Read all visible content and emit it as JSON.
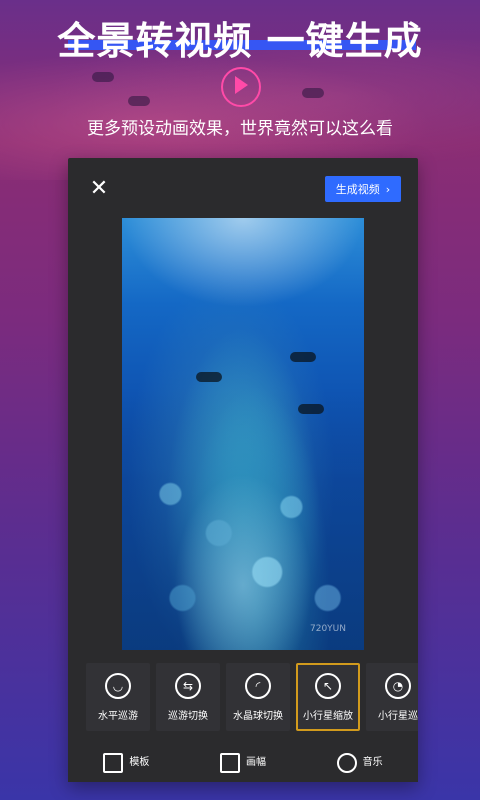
{
  "header": {
    "title": "全景转视频 一键生成",
    "subtitle": "更多预设动画效果，世界竟然可以这么看"
  },
  "phone": {
    "close_label": "✕",
    "generate_label": "生成视频",
    "generate_chevron": "›",
    "watermark": "720YUN"
  },
  "templates": [
    {
      "label": "水平巡游",
      "icon": "horizontal-tour-icon"
    },
    {
      "label": "巡游切换",
      "icon": "tour-switch-icon"
    },
    {
      "label": "水晶球切换",
      "icon": "crystal-ball-icon"
    },
    {
      "label": "小行星缩放",
      "icon": "planet-zoom-icon",
      "selected": true
    },
    {
      "label": "小行星巡",
      "icon": "planet-tour-icon"
    }
  ],
  "bottom_nav": [
    {
      "label": "模板",
      "icon": "layers-icon",
      "active": true
    },
    {
      "label": "画幅",
      "icon": "frame-icon",
      "active": false
    },
    {
      "label": "音乐",
      "icon": "music-note-icon",
      "active": false
    }
  ],
  "colors": {
    "accent_blue": "#2f6bff",
    "selected_outline": "#d29b1d",
    "play_pink": "#ff4aa8"
  }
}
